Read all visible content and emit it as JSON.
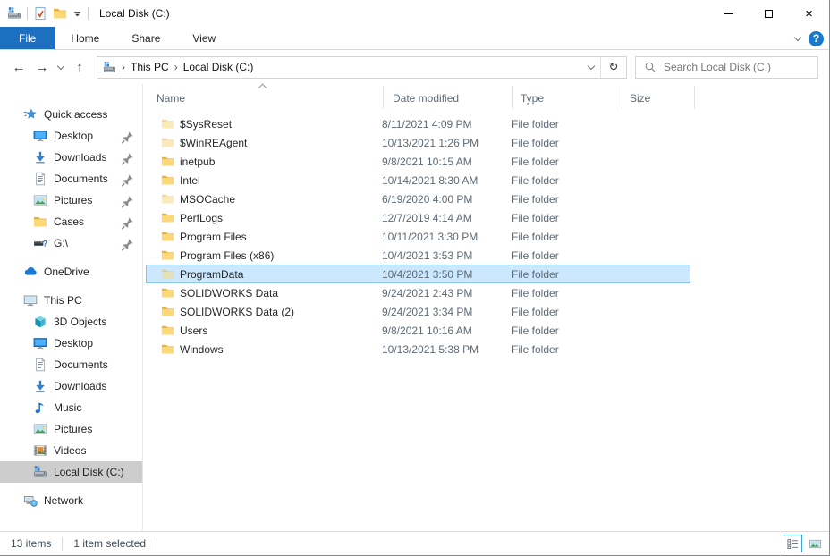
{
  "window": {
    "title": "Local Disk (C:)"
  },
  "titlebar": {
    "quick_access_icons": [
      "drive-icon",
      "properties-icon",
      "new-folder-icon",
      "customize-dropdown-icon"
    ],
    "controls": [
      "minimize",
      "maximize",
      "close"
    ]
  },
  "ribbon": {
    "file_tab": "File",
    "tabs": [
      "Home",
      "Share",
      "View"
    ],
    "help_icon": "help-icon",
    "expand_icon": "chevron-down-icon"
  },
  "address": {
    "crumbs": [
      "This PC",
      "Local Disk (C:)"
    ],
    "drive_icon": "drive-icon"
  },
  "search": {
    "placeholder": "Search Local Disk (C:)"
  },
  "sidebar": {
    "sections": [
      {
        "label": "Quick access",
        "icon": "star",
        "items": [
          {
            "label": "Desktop",
            "icon": "desktop",
            "pinned": true
          },
          {
            "label": "Downloads",
            "icon": "downloads",
            "pinned": true
          },
          {
            "label": "Documents",
            "icon": "document",
            "pinned": true
          },
          {
            "label": "Pictures",
            "icon": "picture",
            "pinned": true
          },
          {
            "label": "Cases",
            "icon": "folder",
            "pinned": true
          },
          {
            "label": "G:\\",
            "icon": "drive-question",
            "pinned": true
          }
        ]
      },
      {
        "label": "OneDrive",
        "icon": "cloud",
        "items": []
      },
      {
        "label": "This PC",
        "icon": "pc",
        "items": [
          {
            "label": "3D Objects",
            "icon": "cube"
          },
          {
            "label": "Desktop",
            "icon": "desktop"
          },
          {
            "label": "Documents",
            "icon": "document"
          },
          {
            "label": "Downloads",
            "icon": "downloads"
          },
          {
            "label": "Music",
            "icon": "music"
          },
          {
            "label": "Pictures",
            "icon": "picture"
          },
          {
            "label": "Videos",
            "icon": "video"
          },
          {
            "label": "Local Disk (C:)",
            "icon": "drive",
            "selected": true
          }
        ]
      },
      {
        "label": "Network",
        "icon": "network",
        "items": []
      }
    ]
  },
  "files": {
    "columns": [
      "Name",
      "Date modified",
      "Type",
      "Size"
    ],
    "sort": {
      "column": "Name",
      "direction": "ascending"
    },
    "rows": [
      {
        "name": "$SysReset",
        "date": "8/11/2021 4:09 PM",
        "type": "File folder",
        "size": "",
        "hidden": true
      },
      {
        "name": "$WinREAgent",
        "date": "10/13/2021 1:26 PM",
        "type": "File folder",
        "size": "",
        "hidden": true
      },
      {
        "name": "inetpub",
        "date": "9/8/2021 10:15 AM",
        "type": "File folder",
        "size": ""
      },
      {
        "name": "Intel",
        "date": "10/14/2021 8:30 AM",
        "type": "File folder",
        "size": ""
      },
      {
        "name": "MSOCache",
        "date": "6/19/2020 4:00 PM",
        "type": "File folder",
        "size": "",
        "hidden": true
      },
      {
        "name": "PerfLogs",
        "date": "12/7/2019 4:14 AM",
        "type": "File folder",
        "size": ""
      },
      {
        "name": "Program Files",
        "date": "10/11/2021 3:30 PM",
        "type": "File folder",
        "size": ""
      },
      {
        "name": "Program Files (x86)",
        "date": "10/4/2021 3:53 PM",
        "type": "File folder",
        "size": ""
      },
      {
        "name": "ProgramData",
        "date": "10/4/2021 3:50 PM",
        "type": "File folder",
        "size": "",
        "hidden": true,
        "selected": true
      },
      {
        "name": "SOLIDWORKS Data",
        "date": "9/24/2021 2:43 PM",
        "type": "File folder",
        "size": ""
      },
      {
        "name": "SOLIDWORKS Data (2)",
        "date": "9/24/2021 3:34 PM",
        "type": "File folder",
        "size": ""
      },
      {
        "name": "Users",
        "date": "9/8/2021 10:16 AM",
        "type": "File folder",
        "size": ""
      },
      {
        "name": "Windows",
        "date": "10/13/2021 5:38 PM",
        "type": "File folder",
        "size": ""
      }
    ]
  },
  "statusbar": {
    "items_count": "13 items",
    "selected_count": "1 item selected",
    "view_buttons": [
      "details-view",
      "thumbnail-view"
    ]
  },
  "colors": {
    "file_tab_blue": "#1d6fc0",
    "help_blue": "#1979ca",
    "selection_bg": "#cce8ff",
    "selection_border": "#84c3ea",
    "sidebar_selected_bg": "#cdcdcd",
    "folder_yellow": "#fbd978",
    "active_view_border": "#39a3dc"
  }
}
